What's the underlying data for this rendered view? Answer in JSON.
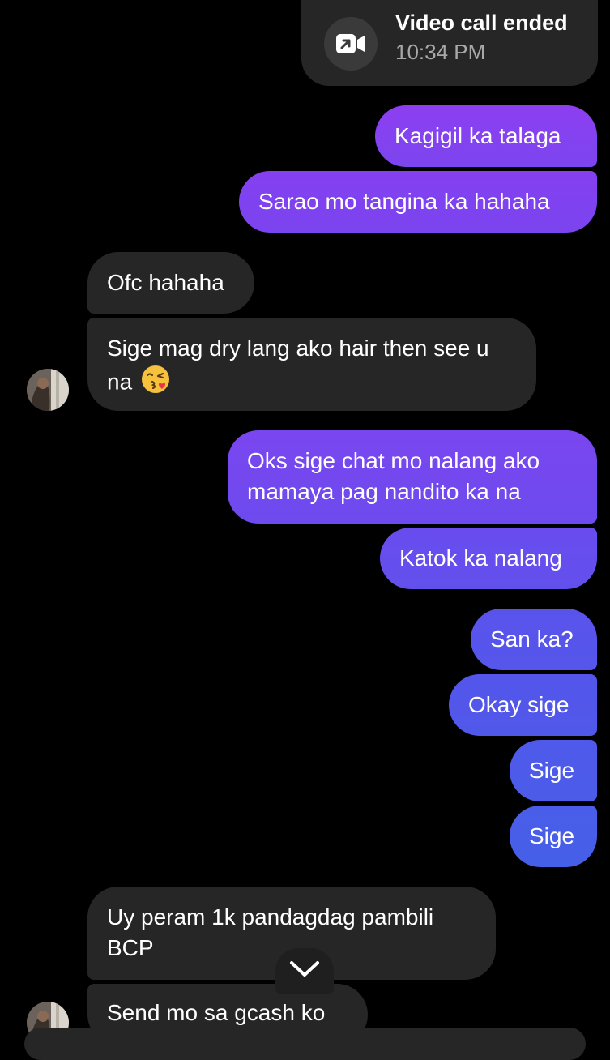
{
  "call_event": {
    "title": "Video call ended",
    "time": "10:34 PM",
    "icon": "video-call-icon"
  },
  "messages": [
    {
      "id": "m1",
      "side": "out",
      "text": "Kagigil ka talaga"
    },
    {
      "id": "m2",
      "side": "out",
      "text": "Sarao mo tangina ka hahaha"
    },
    {
      "id": "m3",
      "side": "in",
      "text": "Ofc hahaha"
    },
    {
      "id": "m4",
      "side": "in",
      "text": "Sige mag dry lang ako hair then see u na",
      "emoji": "kissing-face-emoji"
    },
    {
      "id": "m5",
      "side": "out",
      "text": "Oks sige chat mo nalang ako mamaya pag nandito ka na"
    },
    {
      "id": "m6",
      "side": "out",
      "text": "Katok ka nalang"
    },
    {
      "id": "m7",
      "side": "out",
      "text": "San ka?"
    },
    {
      "id": "m8",
      "side": "out",
      "text": "Okay sige"
    },
    {
      "id": "m9",
      "side": "out",
      "text": "Sige"
    },
    {
      "id": "m10",
      "side": "out",
      "text": "Sige"
    },
    {
      "id": "m11",
      "side": "in",
      "text": "Uy peram 1k pandagdag pambili BCP"
    },
    {
      "id": "m12",
      "side": "in",
      "text": "Send mo sa gcash ko"
    }
  ],
  "colors": {
    "background": "#000000",
    "incoming_bubble": "#262626",
    "outgoing_gradient_top": "#8a3ff0",
    "outgoing_gradient_bottom": "#3e5fe0",
    "secondary_text": "#a8a8a8"
  },
  "scroll_button": {
    "icon": "chevron-down-icon"
  }
}
